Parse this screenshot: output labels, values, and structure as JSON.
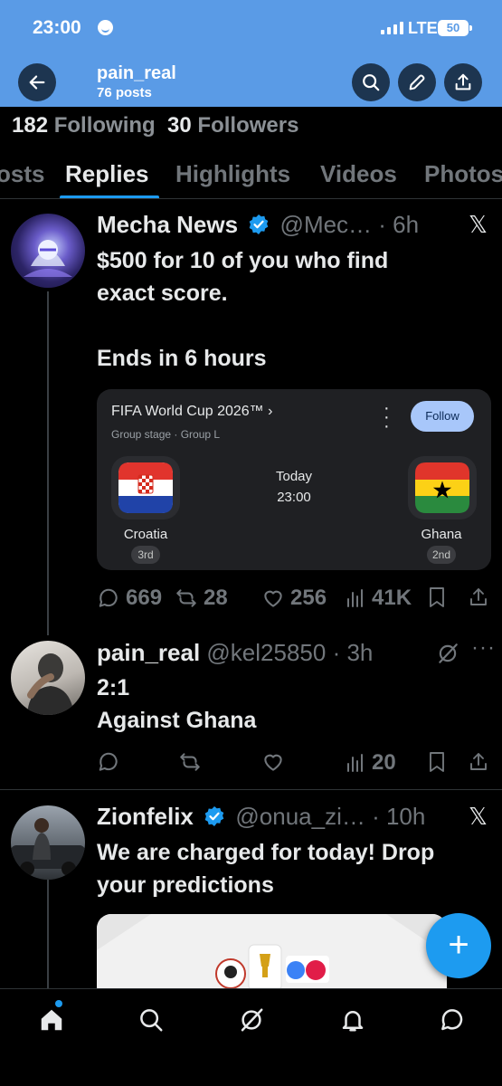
{
  "status_bar": {
    "time": "23:00",
    "network": "LTE",
    "battery": "50"
  },
  "header": {
    "profile_name": "pain_real",
    "posts_count": "76 posts"
  },
  "counts": {
    "following_num": "182",
    "following_label": "Following",
    "followers_num": "30",
    "followers_label": "Followers"
  },
  "tabs": [
    "osts",
    "Replies",
    "Highlights",
    "Videos",
    "Photos"
  ],
  "active_tab": "Replies",
  "tweets": [
    {
      "name": "Mecha News",
      "handle": "@Mec…",
      "time": "· 6h",
      "text": "$500 for 10 of you who find\nexact score.\n\nEnds in 6 hours",
      "stats": {
        "replies": "669",
        "reposts": "28",
        "likes": "256",
        "views": "41K"
      }
    },
    {
      "name": "pain_real",
      "handle": "@kel25850",
      "time": "· 3h",
      "text": "2:1\nAgainst Ghana",
      "stats": {
        "views": "20"
      }
    },
    {
      "name": "Zionfelix",
      "handle": "@onua_zi…",
      "time": "· 10h",
      "text": "We are charged for today! Drop\nyour predictions"
    }
  ],
  "fifa_card": {
    "title": "FIFA World Cup 2026™ ›",
    "subtitle": "Group stage · Group L",
    "follow_label": "Follow",
    "day": "Today",
    "time": "23:00",
    "home_team": "Croatia",
    "home_rank": "3rd",
    "away_team": "Ghana",
    "away_rank": "2nd"
  },
  "colors": {
    "accent": "#1d9bf0",
    "header_bg": "#5a9be6",
    "background": "#000000",
    "muted": "#71767b"
  },
  "icons": [
    "back-arrow-icon",
    "search-icon",
    "edit-icon",
    "share-icon",
    "x-logo-icon",
    "reply-icon",
    "repost-icon",
    "like-icon",
    "views-icon",
    "bookmark-icon",
    "mute-icon",
    "more-icon",
    "home-icon",
    "explore-icon",
    "grok-icon",
    "notifications-icon",
    "messages-icon",
    "compose-icon"
  ]
}
